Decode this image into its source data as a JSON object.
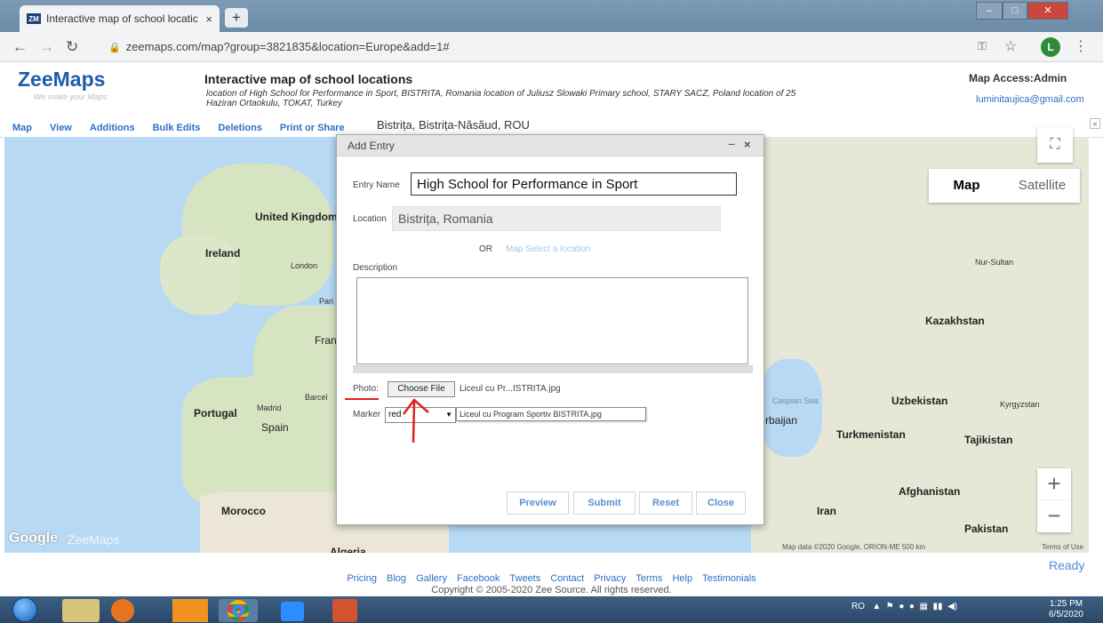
{
  "browser": {
    "tab_title": "Interactive map of school locatic",
    "tab_favicon": "ZM",
    "tab_close": "×",
    "new_tab": "+",
    "url": "zeemaps.com/map?group=3821835&location=Europe&add=1#",
    "profile_initial": "L"
  },
  "site": {
    "brand": "ZeeMaps",
    "tagline": "We make your Maps",
    "map_title": "Interactive map of school locations",
    "map_description": "location of High School for Performance in Sport, BISTRITA, Romania location of Juliusz Slowaki Primary school, STARY SACZ, Poland location of 25 Haziran Ortaokulu, TOKAT, Turkey",
    "access_label": "Map Access:Admin",
    "user_email": "luminitaujica@gmail.com"
  },
  "menu": {
    "items": [
      "Map",
      "View",
      "Additions",
      "Bulk Edits",
      "Deletions",
      "Print or Share"
    ],
    "current_location": "Bistrița, Bistrița-Năsăud, ROU"
  },
  "map": {
    "type_buttons": {
      "map": "Map",
      "satellite": "Satellite"
    },
    "labels": {
      "uk": "United Kingdom",
      "ireland": "Ireland",
      "london": "London",
      "paris": "Pari",
      "france": "Fran",
      "portugal": "Portugal",
      "madrid": "Madrid",
      "spain": "Spain",
      "barcelona": "Barcel",
      "morocco": "Morocco",
      "algeria": "Algeria",
      "kazakhstan": "Kazakhstan",
      "nursultan": "Nur-Sultan",
      "uzbekistan": "Uzbekistan",
      "kyrgyzstan": "Kyrgyzstan",
      "turkmenistan": "Turkmenistan",
      "tajikistan": "Tajikistan",
      "afghanistan": "Afghanistan",
      "iran": "Iran",
      "pakistan": "Pakistan",
      "azerbaijan": "rbaijan",
      "caspian": "Caspian Sea"
    },
    "google_logo": "Google",
    "zee_watermark": "ZeeMaps",
    "attribution": "Map data ©2020 Google, ORION-ME   500 km",
    "terms": "Terms of Use",
    "zoom_in": "+",
    "zoom_out": "−"
  },
  "dialog": {
    "title": "Add Entry",
    "minimize": "−",
    "close_x": "×",
    "entry_name_label": "Entry Name",
    "entry_name_value": "High School for Performance in Sport",
    "location_label": "Location",
    "location_value": "Bistrița, Romania",
    "or_text": "OR",
    "map_select_link": "Map Select a location",
    "description_label": "Description",
    "description_value": "",
    "photo_label": "Photo:",
    "choose_file": "Choose File",
    "file_name": "Liceul cu Pr...ISTRITA.jpg",
    "marker_label": "Marker",
    "marker_value": "red",
    "file_tooltip": "Liceul cu Program Sportiv BISTRITA.jpg",
    "buttons": {
      "preview": "Preview",
      "submit": "Submit",
      "reset": "Reset",
      "close": "Close"
    }
  },
  "status": {
    "ready": "Ready"
  },
  "footer": {
    "links": [
      "Pricing",
      "Blog",
      "Gallery",
      "Facebook",
      "Tweets",
      "Contact",
      "Privacy",
      "Terms",
      "Help",
      "Testimonials"
    ],
    "copyright": "Copyright © 2005-2020 Zee Source. All rights reserved."
  },
  "taskbar": {
    "lang": "RO",
    "time": "1:25 PM",
    "date": "6/5/2020"
  }
}
